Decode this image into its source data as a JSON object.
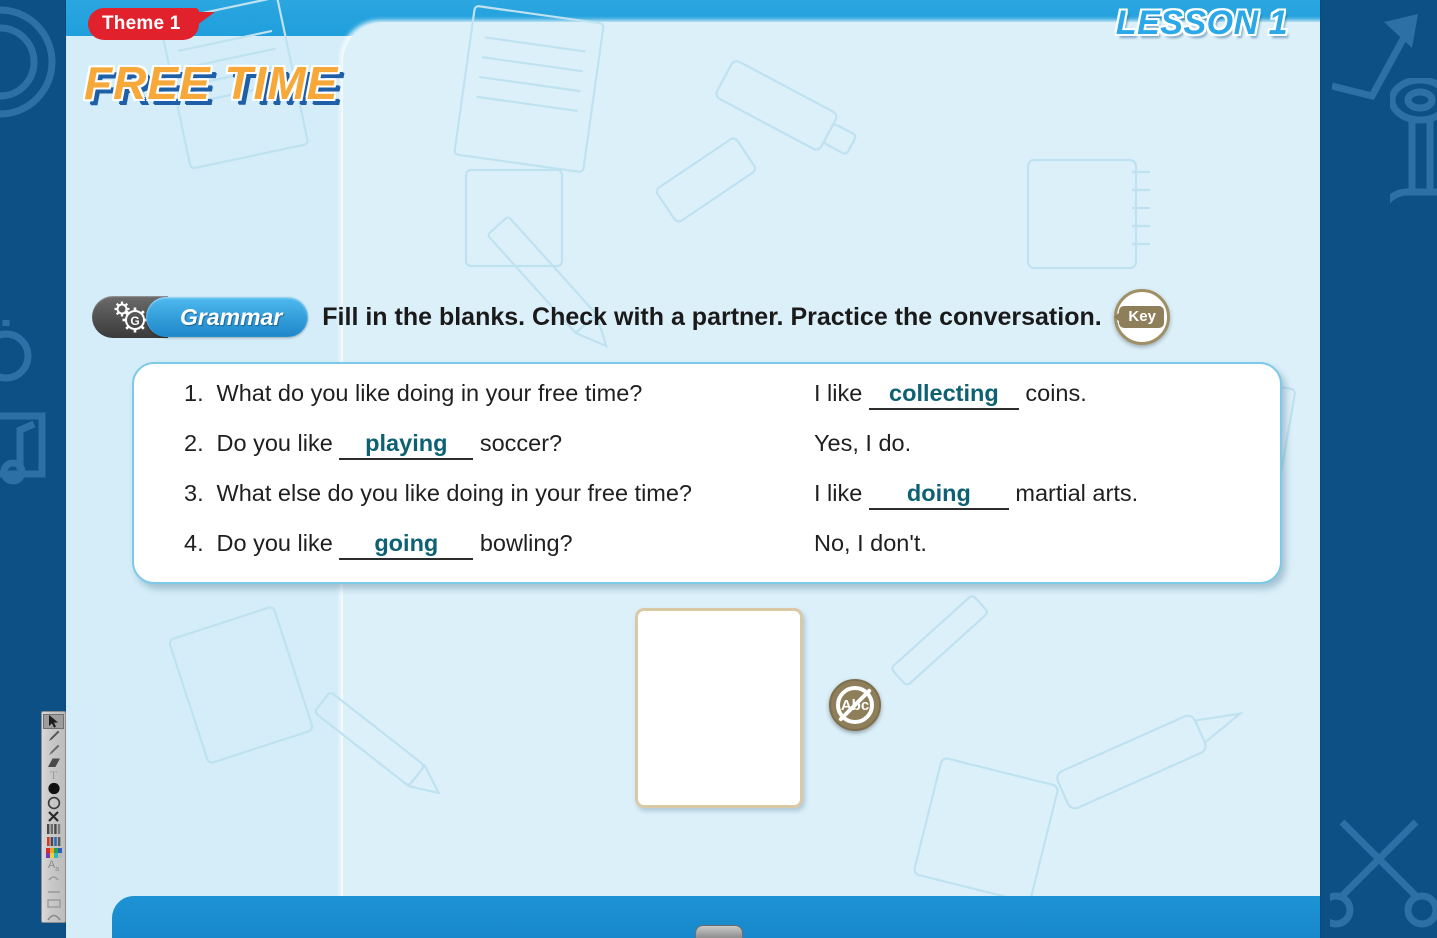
{
  "window": {
    "bg_dark_blue": "#0d5086",
    "page_bg": "#dcf0fa"
  },
  "header": {
    "theme_label": "Theme 1",
    "title": "FREE TIME",
    "lesson_label": "LESSON 1",
    "theme_badge_color": "#e1222c",
    "title_color": "#f7a838",
    "lesson_color": "#2aa8e8"
  },
  "instruction": {
    "skill_icon": "gear-g-icon",
    "skill_label": "Grammar",
    "text": "Fill in the blanks. Check with a partner. Practice the conversation.",
    "key_button_label": "Key",
    "skill_pill_color": "#1c86c9",
    "key_accent_color": "#8e7f5a"
  },
  "exercise": {
    "answer_color": "#0d6172",
    "rows": [
      {
        "number": "1.",
        "question_before": "What do you like doing in your free time?",
        "question_blank": "",
        "question_after": "",
        "answer_before": "I like",
        "answer_blank": "collecting",
        "answer_after": "coins."
      },
      {
        "number": "2.",
        "question_before": "Do you like",
        "question_blank": "playing",
        "question_after": "soccer?",
        "answer_before": "Yes, I do.",
        "answer_blank": "",
        "answer_after": ""
      },
      {
        "number": "3.",
        "question_before": "What else do you like doing in your free time?",
        "question_blank": "",
        "question_after": "",
        "answer_before": "I like",
        "answer_blank": "doing",
        "answer_after": "martial arts."
      },
      {
        "number": "4.",
        "question_before": "Do you like",
        "question_blank": "going",
        "question_after": "bowling?",
        "answer_before": "No, I don't.",
        "answer_blank": "",
        "answer_after": ""
      }
    ]
  },
  "media": {
    "image_card_name": "image-placeholder-card",
    "audio_button_label": "Abc",
    "audio_button_name": "no-text-abc-button"
  },
  "toolbar": {
    "items": [
      {
        "name": "select-cursor-icon",
        "glyph": "↖",
        "selected": true
      },
      {
        "name": "pen-icon",
        "glyph": "╱",
        "selected": false
      },
      {
        "name": "highlighter-icon",
        "glyph": "╱",
        "selected": false
      },
      {
        "name": "eraser-icon",
        "glyph": "◧",
        "selected": false
      },
      {
        "name": "text-tool-icon",
        "glyph": "T",
        "selected": false
      },
      {
        "name": "filled-circle-icon",
        "glyph": "●",
        "selected": false
      },
      {
        "name": "outline-circle-icon",
        "glyph": "○",
        "selected": false
      },
      {
        "name": "close-x-icon",
        "glyph": "✕",
        "selected": false
      },
      {
        "name": "columns-icon",
        "glyph": "‖‖",
        "selected": false
      },
      {
        "name": "bars-icon",
        "glyph": "‖‖",
        "selected": false
      },
      {
        "name": "color-palette-icon",
        "glyph": "",
        "selected": false
      },
      {
        "name": "text-size-icon",
        "glyph": "A",
        "selected": false
      },
      {
        "name": "undo-icon",
        "glyph": "↶",
        "selected": false
      },
      {
        "name": "line-icon",
        "glyph": "—",
        "selected": false
      },
      {
        "name": "shape-icon",
        "glyph": "⌒",
        "selected": false
      },
      {
        "name": "curve-icon",
        "glyph": "⌒",
        "selected": false
      }
    ]
  }
}
